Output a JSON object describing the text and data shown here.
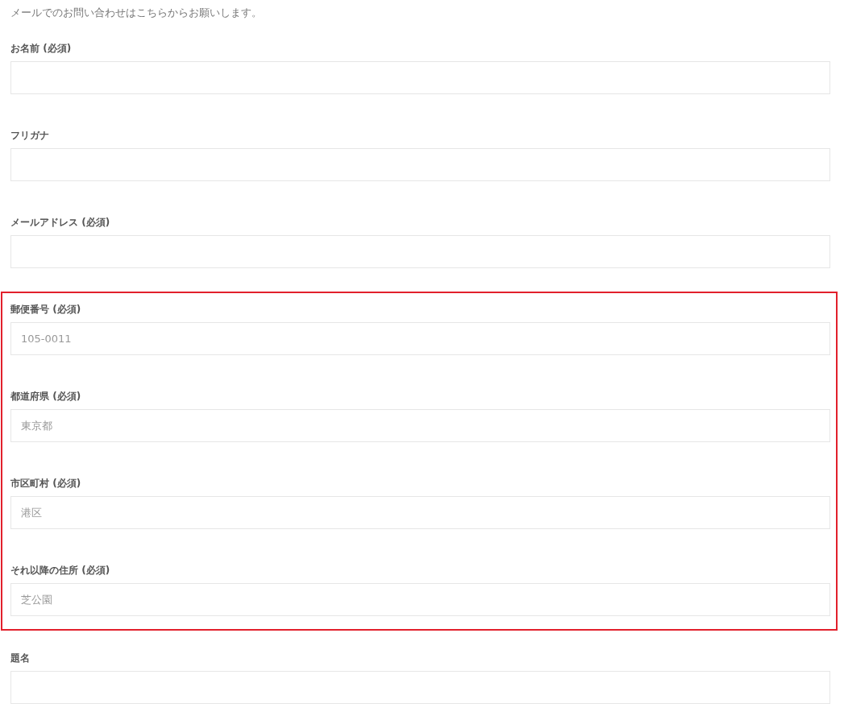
{
  "intro": "メールでのお問い合わせはこちらからお願いします。",
  "fields": [
    {
      "label": "お名前 (必須)"
    },
    {
      "label": "フリガナ"
    },
    {
      "label": "メールアドレス (必須)"
    }
  ],
  "highlighted_section": {
    "fields": [
      {
        "label": "郵便番号 (必須)",
        "placeholder": "105-0011"
      },
      {
        "label": "都道府県 (必須)",
        "placeholder": "東京都"
      },
      {
        "label": "市区町村 (必須)",
        "placeholder": "港区"
      },
      {
        "label": "それ以降の住所 (必須)",
        "placeholder": "芝公園"
      }
    ]
  },
  "fields_after": [
    {
      "label": "題名"
    }
  ]
}
